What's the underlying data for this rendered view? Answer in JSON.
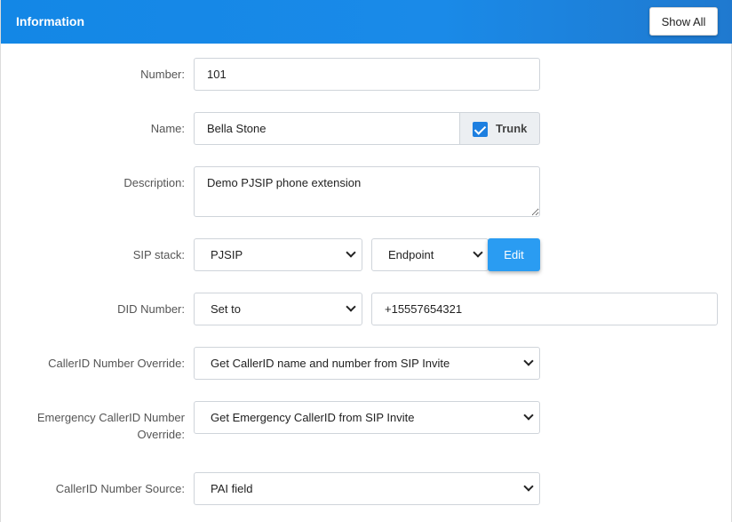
{
  "header": {
    "title": "Information",
    "show_all_label": "Show All"
  },
  "form": {
    "number": {
      "label": "Number:",
      "value": "101"
    },
    "name": {
      "label": "Name:",
      "value": "Bella Stone",
      "trunk_label": "Trunk",
      "trunk_checked": true
    },
    "description": {
      "label": "Description:",
      "value": "Demo PJSIP phone extension"
    },
    "sip_stack": {
      "label": "SIP stack:",
      "stack_value": "PJSIP",
      "mode_value": "Endpoint",
      "edit_label": "Edit"
    },
    "did_number": {
      "label": "DID Number:",
      "mode_value": "Set to",
      "value": "+15557654321"
    },
    "callerid_override": {
      "label": "CallerID Number Override:",
      "value": "Get CallerID name and number from SIP Invite"
    },
    "emergency_override": {
      "label_line1": "Emergency CallerID Number",
      "label_line2": "Override:",
      "value": "Get Emergency CallerID from SIP Invite"
    },
    "callerid_source": {
      "label": "CallerID Number Source:",
      "value": "PAI field"
    }
  },
  "colors": {
    "header": "#1a8ae8",
    "accent": "#2a9cf2",
    "checkbox": "#1d7fe0"
  }
}
